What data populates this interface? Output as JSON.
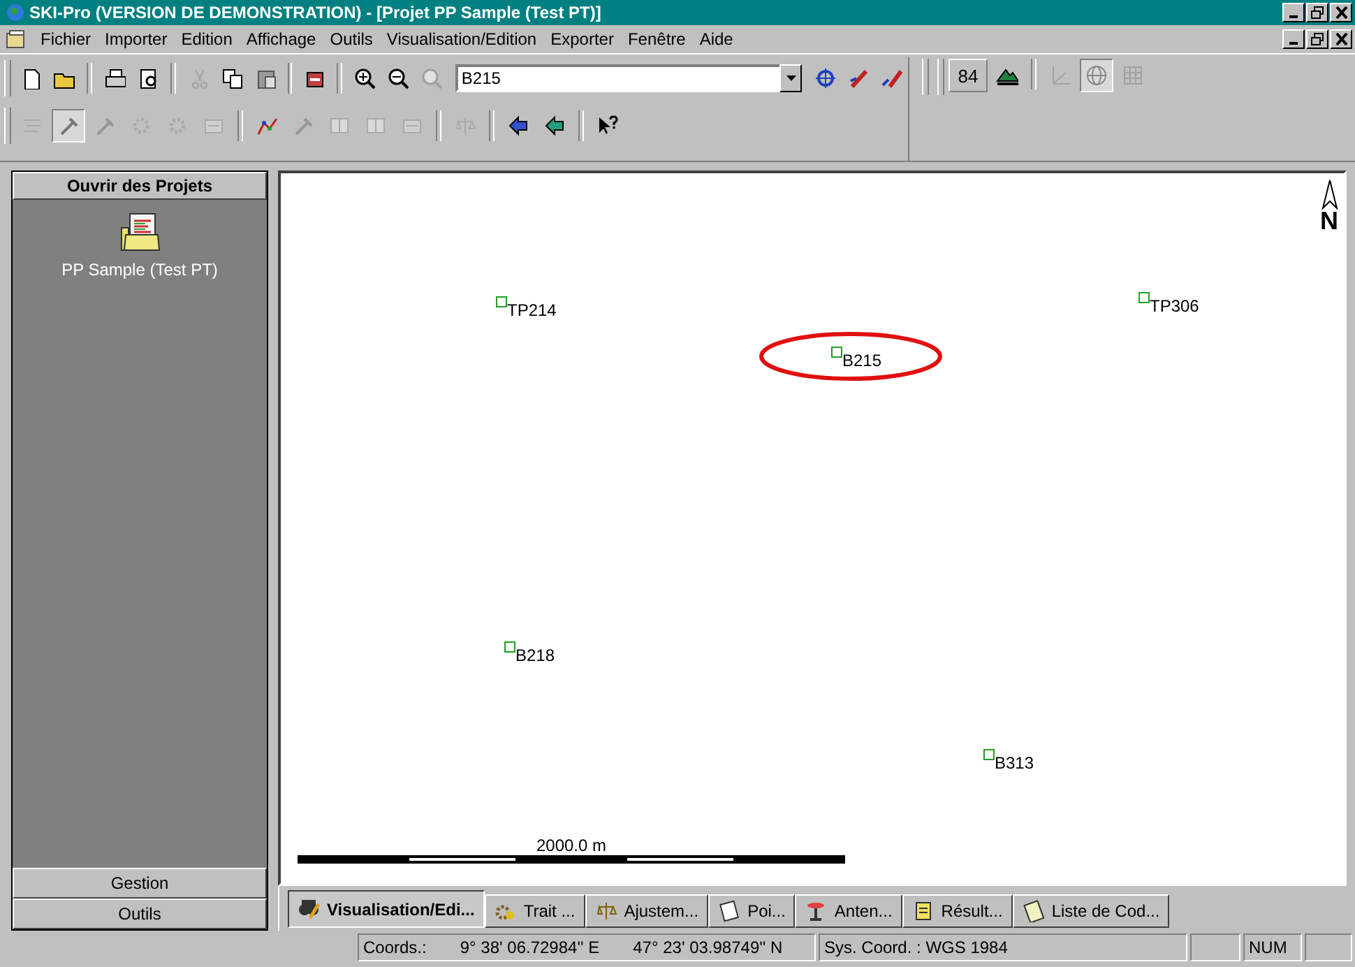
{
  "window": {
    "title": "SKI-Pro (VERSION DE DEMONSTRATION) - [Projet PP Sample (Test PT)]"
  },
  "menu": [
    "Fichier",
    "Importer",
    "Edition",
    "Affichage",
    "Outils",
    "Visualisation/Edition",
    "Exporter",
    "Fenêtre",
    "Aide"
  ],
  "toolbar": {
    "point_field": {
      "value": "B215"
    },
    "epoch_button": "84"
  },
  "sidebar": {
    "header": "Ouvrir des Projets",
    "items": [
      {
        "label": "PP Sample (Test PT)"
      }
    ],
    "buttons": [
      "Gestion",
      "Outils"
    ]
  },
  "map": {
    "north": "N",
    "points": [
      {
        "label": "TP214",
        "highlighted": false
      },
      {
        "label": "B215",
        "highlighted": true
      },
      {
        "label": "TP306",
        "highlighted": false
      },
      {
        "label": "B218",
        "highlighted": false
      },
      {
        "label": "B313",
        "highlighted": false
      }
    ],
    "scale": "2000.0 m"
  },
  "tabs": [
    {
      "label": "Visualisation/Edi...",
      "selected": true
    },
    {
      "label": "Trait ...",
      "selected": false
    },
    {
      "label": "Ajustem...",
      "selected": false
    },
    {
      "label": "Poi...",
      "selected": false
    },
    {
      "label": "Anten...",
      "selected": false
    },
    {
      "label": "Résult...",
      "selected": false
    },
    {
      "label": "Liste de Cod...",
      "selected": false
    }
  ],
  "status_bar": {
    "coords_label": "Coords.:",
    "longitude": "9° 38' 06.72984'' E",
    "latitude": "47° 23' 03.98749'' N",
    "system": "Sys. Coord. : WGS 1984",
    "num": "NUM"
  }
}
